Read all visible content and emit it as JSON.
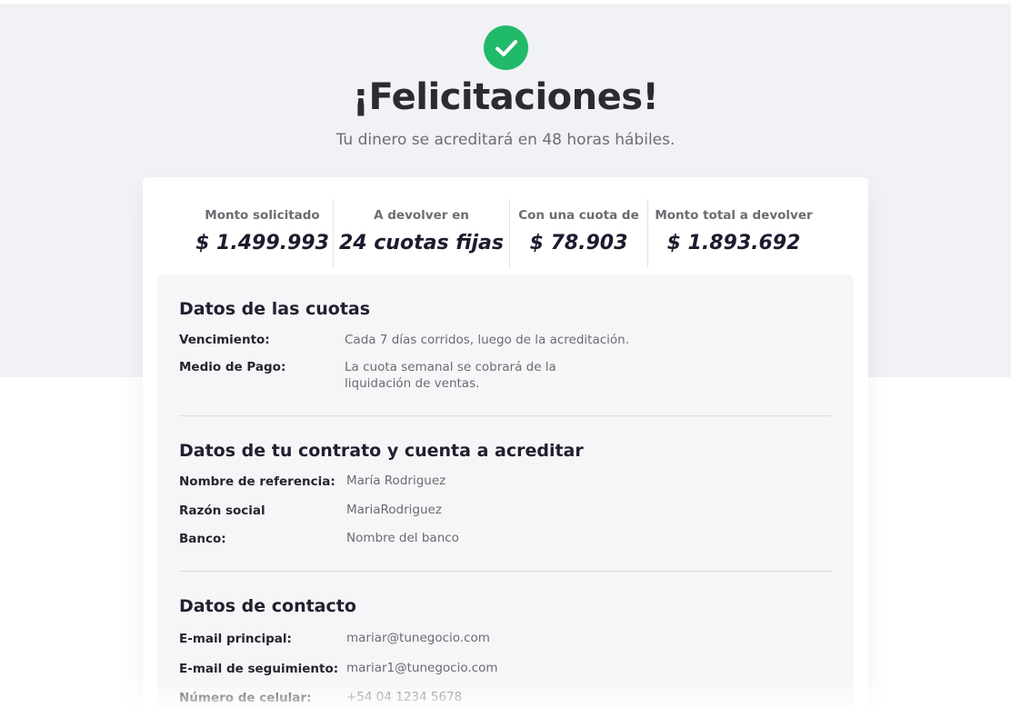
{
  "header": {
    "icon": "check-circle-icon",
    "accent_color": "#21b96a",
    "title": "¡Felicitaciones!",
    "subtitle": "Tu dinero se acreditará en 48 horas hábiles."
  },
  "summary": [
    {
      "label": "Monto solicitado",
      "value": "$ 1.499.993"
    },
    {
      "label": "A devolver en",
      "value": "24 cuotas fijas"
    },
    {
      "label": "Con una cuota de",
      "value": "$ 78.903"
    },
    {
      "label": "Monto total a devolver",
      "value": "$ 1.893.692"
    }
  ],
  "sections": {
    "cuotas": {
      "title": "Datos de las cuotas",
      "rows": [
        {
          "label": "Vencimiento:",
          "value": "Cada 7 días corridos, luego de la acreditación."
        },
        {
          "label": "Medio de Pago:",
          "value": "La cuota semanal se cobrará de la liquidación de ventas."
        }
      ]
    },
    "contrato": {
      "title": "Datos de tu contrato y cuenta a acreditar",
      "rows": [
        {
          "label": "Nombre de referencia:",
          "value": "María Rodriguez"
        },
        {
          "label": "Razón social",
          "value": "MariaRodriguez"
        },
        {
          "label": "Banco:",
          "value": "Nombre del banco"
        }
      ]
    },
    "contacto": {
      "title": "Datos de contacto",
      "rows": [
        {
          "label": "E-mail principal:",
          "value": "mariar@tunegocio.com"
        },
        {
          "label": "E-mail de seguimiento:",
          "value": "mariar1@tunegocio.com"
        },
        {
          "label": "Número de celular:",
          "value": "+54 04 1234 5678"
        }
      ]
    }
  }
}
